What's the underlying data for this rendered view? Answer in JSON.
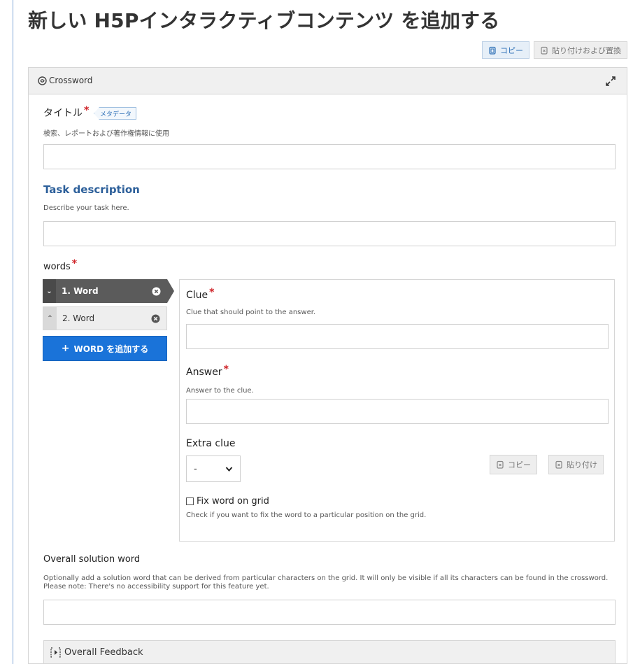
{
  "page": {
    "title": "新しい H5Pインタラクティブコンテンツ を追加する",
    "copy_label": "コピー",
    "paste_replace_label": "貼り付けおよび置換"
  },
  "editor": {
    "library_name": "Crossword",
    "title_field": {
      "label": "タイトル",
      "required": "*",
      "metadata_label": "メタデータ",
      "description": "検索、レポートおよび著作権情報に使用",
      "value": ""
    },
    "task_description": {
      "label": "Task description",
      "description": "Describe your task here.",
      "value": ""
    },
    "words": {
      "label": "words",
      "required": "*",
      "items": [
        {
          "label": "1. Word",
          "active": true
        },
        {
          "label": "2. Word",
          "active": false
        }
      ],
      "add_button_label": "WORD を追加する"
    },
    "word_form": {
      "clue_label": "Clue",
      "clue_required": "*",
      "clue_description": "Clue that should point to the answer.",
      "clue_value": "",
      "answer_label": "Answer",
      "answer_required": "*",
      "answer_description": "Answer to the clue.",
      "answer_value": "",
      "extra_clue_label": "Extra clue",
      "extra_clue_selected": "-",
      "copy_label": "コピー",
      "paste_label": "貼り付け",
      "fix_word_label": "Fix word on grid",
      "fix_word_checked": false,
      "fix_word_description": "Check if you want to fix the word to a particular position on the grid."
    },
    "solution_word": {
      "label": "Overall solution word",
      "description": "Optionally add a solution word that can be derived from particular characters on the grid. It will only be visible if all its characters can be found in the crossword. Please note: There's no accessibility support for this feature yet.",
      "value": ""
    },
    "overall_feedback_label": "Overall Feedback"
  },
  "icons": {
    "library": "hub-logo-icon",
    "expand": "expand-icon",
    "remove": "remove-icon",
    "feedback": "expand-group-icon"
  },
  "colors": {
    "accent_blue": "#1a73d9",
    "heading_blue": "#2c5f9a",
    "required_red": "#d0262b",
    "active_tab": "#5b5b5b"
  }
}
